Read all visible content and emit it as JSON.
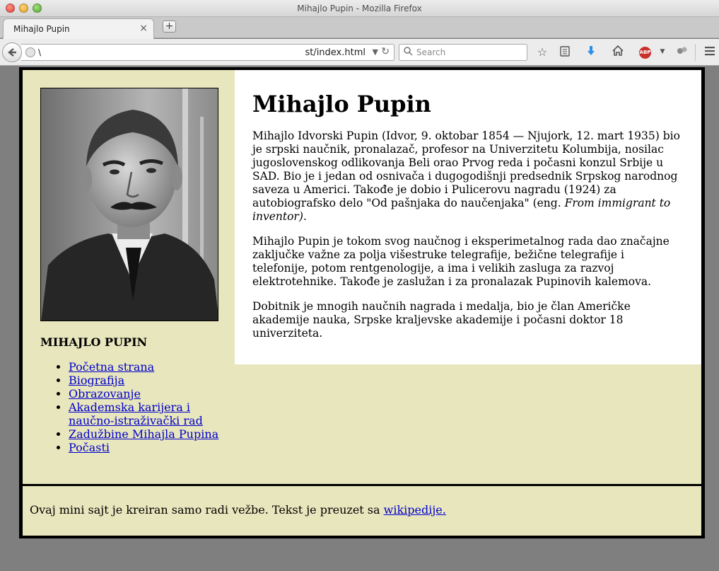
{
  "window": {
    "title": "Mihajlo Pupin - Mozilla Firefox"
  },
  "tabs": [
    {
      "label": "Mihajlo Pupin",
      "close": "×"
    }
  ],
  "toolbar": {
    "new_tab": "+",
    "url_left": "\\",
    "url": "st/index.html",
    "search_placeholder": "Search",
    "abp_label": "ABP"
  },
  "page": {
    "heading": "Mihajlo Pupin",
    "paragraphs": {
      "p1": "Mihajlo Idvorski Pupin (Idvor, 9. oktobar 1854 — Njujork, 12. mart 1935) bio je srpski naučnik, pronalazač, profesor na Univerzitetu Kolumbija, nosilac jugoslovenskog odlikovanja Beli orao Prvog reda i počasni konzul Srbije u SAD. Bio je i jedan od osnivača i dugogodišnji predsednik Srpskog narodnog saveza u Americi. Takođe je dobio i Pulicerovu nagradu (1924) za autobiografsko delo \"Od pašnjaka do naučenjaka\" (eng. ",
      "p1_italic": "From immigrant to inventor)",
      "p1_end": ".",
      "p2": "Mihajlo Pupin je tokom svog naučnog i eksperimetalnog rada dao značajne zaključke važne za polja višestruke telegrafije, bežične telegrafije i telefonije, potom rentgenologije, a ima i velikih zasluga za razvoj elektrotehnike. Takođe je zaslužan i za pronalazak Pupinovih kalemova.",
      "p3": "Dobitnik je mnogih naučnih nagrada i medalja, bio je član Američke akademije nauka, Srpske kraljevske akademije i počasni doktor 18 univerziteta."
    },
    "sidebar": {
      "title": "MIHAJLO PUPIN",
      "links": [
        "Početna strana",
        "Biografija",
        "Obrazovanje",
        "Akademska karijera i naučno-istraživački rad",
        "Zadužbine Mihajla Pupina",
        "Počasti"
      ]
    },
    "footer": {
      "text": "Ovaj mini sajt je kreiran samo radi vežbe. Tekst je preuzet sa ",
      "link": "wikipedije."
    }
  },
  "colors": {
    "page_background": "#e8e6bd",
    "border": "#000000",
    "link": "#0000cc"
  }
}
